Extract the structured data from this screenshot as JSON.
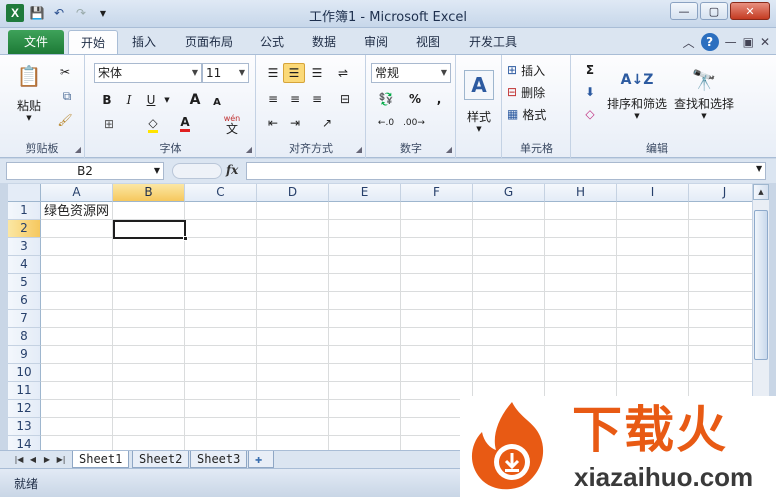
{
  "window": {
    "title": "工作簿1 - Microsoft Excel",
    "qat": {
      "app_icon": "X",
      "save": "💾",
      "undo": "↶",
      "redo": "↷"
    },
    "buttons": {
      "minimize": "—",
      "maximize": "▢",
      "close": "✕"
    }
  },
  "tabs": {
    "file": "文件",
    "items": [
      "开始",
      "插入",
      "页面布局",
      "公式",
      "数据",
      "审阅",
      "视图",
      "开发工具"
    ],
    "active": "开始"
  },
  "ribbon": {
    "clipboard": {
      "label": "剪贴板",
      "paste": "粘贴"
    },
    "font": {
      "label": "字体",
      "family": "宋体",
      "size": "11",
      "bold": "B",
      "italic": "I",
      "underline": "U",
      "grow": "A",
      "shrink": "A",
      "fontcolor": "A",
      "wen": "wén",
      "wen_char": "文"
    },
    "alignment": {
      "label": "对齐方式"
    },
    "number": {
      "label": "数字",
      "format": "常规",
      "percent": "%",
      "comma": ","
    },
    "styles": {
      "label": "样式"
    },
    "cells": {
      "label": "单元格",
      "insert": "插入",
      "delete": "删除",
      "format": "格式"
    },
    "editing": {
      "label": "编辑",
      "sigma": "Σ",
      "sort": "排序和筛选",
      "find": "查找和选择"
    }
  },
  "formula_bar": {
    "name_box": "B2",
    "fx": "fx",
    "value": ""
  },
  "grid": {
    "columns": [
      "A",
      "B",
      "C",
      "D",
      "E",
      "F",
      "G",
      "H",
      "I",
      "J"
    ],
    "rows": [
      "1",
      "2",
      "3",
      "4",
      "5",
      "6",
      "7",
      "8",
      "9",
      "10",
      "11",
      "12",
      "13",
      "14"
    ],
    "selected_column": "B",
    "selected_row": "2",
    "cell_A1": "绿色资源网"
  },
  "sheets": [
    "Sheet1",
    "Sheet2",
    "Sheet3"
  ],
  "active_sheet": "Sheet1",
  "status": "就绪",
  "watermark": {
    "title": "下载火",
    "url": "xiazaihuo.com"
  },
  "colors": {
    "accent": "#1d7a36",
    "selection": "#f6c85e",
    "watermark": "#e85a14"
  }
}
